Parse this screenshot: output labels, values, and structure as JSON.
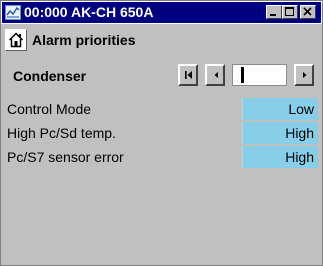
{
  "window": {
    "title": "00:000 AK-CH 650A",
    "app_icon": "app-icon",
    "controls": [
      "minimize-icon",
      "maximize-icon",
      "close-icon"
    ]
  },
  "header": {
    "home_icon": "home-icon",
    "title": "Alarm priorities"
  },
  "section": {
    "label": "Condenser",
    "nav_icons": [
      "first-page-icon",
      "previous-icon",
      "next-icon"
    ],
    "slider_level": 0.14
  },
  "rows": [
    {
      "label": "Control Mode",
      "value": "Low"
    },
    {
      "label": "High Pc/Sd temp.",
      "value": "High"
    },
    {
      "label": "Pc/S7 sensor error",
      "value": "High"
    }
  ],
  "colors": {
    "titlebar": "#000080",
    "panel": "#c0c0c0",
    "value_cell": "#87cee8"
  }
}
